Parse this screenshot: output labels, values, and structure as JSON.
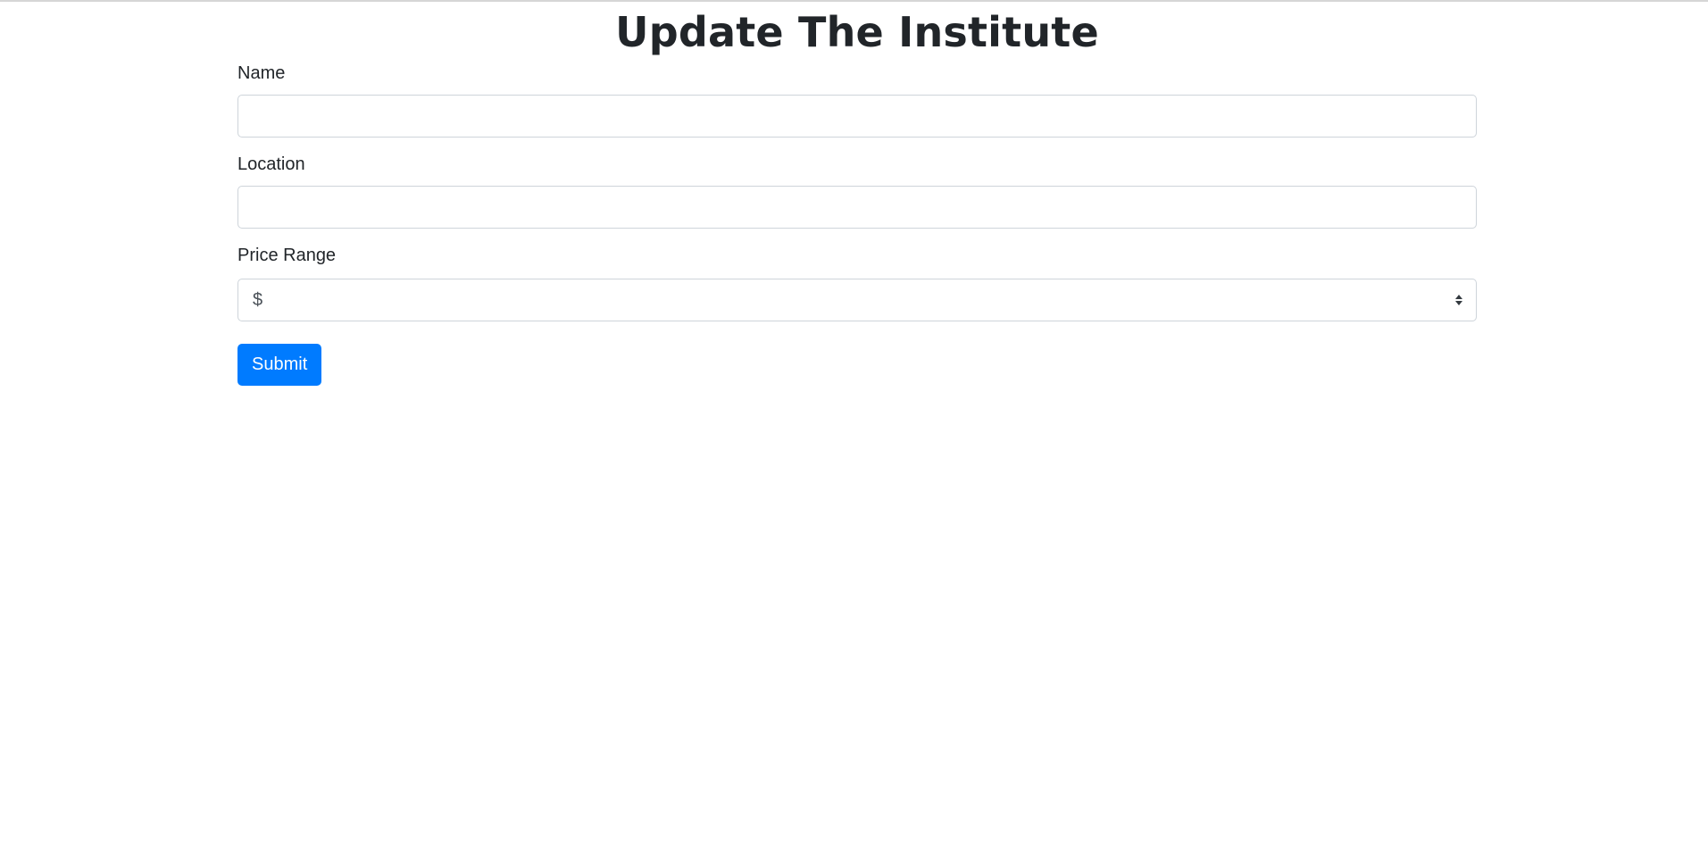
{
  "page": {
    "title": "Update The Institute"
  },
  "form": {
    "name": {
      "label": "Name",
      "value": "",
      "placeholder": ""
    },
    "location": {
      "label": "Location",
      "value": "",
      "placeholder": ""
    },
    "price_range": {
      "label": "Price Range",
      "selected": "$"
    },
    "submit_label": "Submit"
  },
  "colors": {
    "primary": "#007bff",
    "text": "#212529",
    "border": "#ced4da"
  }
}
